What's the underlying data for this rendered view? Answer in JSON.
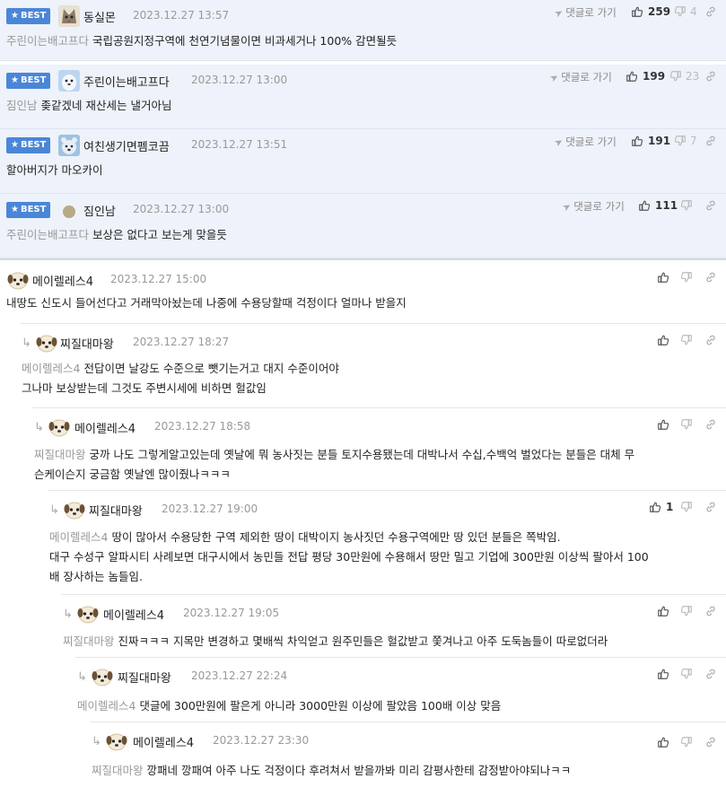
{
  "best": [
    {
      "badge": "BEST",
      "nick": "동실몬",
      "date": "2023.12.27 13:57",
      "reply_link": "댓글로 가기",
      "likes": "259",
      "dislikes": "4",
      "mention": "주린이는배고프다",
      "text": "국립공원지정구역에 천연기념물이면 비과세거나 100% 감면될듯",
      "avatar": "wolf"
    },
    {
      "badge": "BEST",
      "nick": "주린이는배고프다",
      "date": "2023.12.27 13:00",
      "reply_link": "댓글로 가기",
      "likes": "199",
      "dislikes": "23",
      "mention": "짐인남",
      "text": "좆같겠네 재산세는 낼거아님",
      "avatar": "seal"
    },
    {
      "badge": "BEST",
      "nick": "여친생기면펨코끔",
      "date": "2023.12.27 13:51",
      "reply_link": "댓글로 가기",
      "likes": "191",
      "dislikes": "7",
      "mention": "",
      "text": "할아버지가 마오카이",
      "avatar": "bear"
    },
    {
      "badge": "BEST",
      "nick": "짐인남",
      "date": "2023.12.27 13:00",
      "reply_link": "댓글로 가기",
      "likes": "111",
      "dislikes": "",
      "mention": "주린이는배고프다",
      "text": "보상은 없다고 보는게 맞을듯",
      "avatar": "dot"
    }
  ],
  "comments": [
    {
      "nick": "메이렐레스4",
      "date": "2023.12.27 15:00",
      "likes": "",
      "mention": "",
      "lines": [
        "내땅도 신도시 들어선다고 거래막아놨는데 나중에 수용당할때 걱정이다 얼마나 받을지"
      ]
    },
    {
      "nick": "찌질대마왕",
      "date": "2023.12.27 18:27",
      "likes": "",
      "mention": "메이렐레스4",
      "lines": [
        "전답이면 날강도 수준으로 뺏기는거고 대지 수준이어야",
        "그나마 보상받는데 그것도 주변시세에 비하면 헐값임"
      ]
    },
    {
      "nick": "메이렐레스4",
      "date": "2023.12.27 18:58",
      "likes": "",
      "mention": "찌질대마왕",
      "lines": [
        "궁까 나도 그렇게알고있는데 옛날에 뭐 농사짓는 분들 토지수용됐는데 대박나서 수십,수백억 벌었다는 분들은 대체 무",
        "슨케이슨지 궁금함 옛날엔 많이줬나ㅋㅋㅋ"
      ]
    },
    {
      "nick": "찌질대마왕",
      "date": "2023.12.27 19:00",
      "likes": "1",
      "mention": "메이렐레스4",
      "lines": [
        "땅이 많아서 수용당한 구역 제외한 땅이 대박이지 농사짓던 수용구역에만 땅 있던 분들은 쪽박임.",
        "대구 수성구 알파시티 사례보면 대구시에서 농민들 전답 평당 30만원에 수용해서 땅만 밀고 기업에 300만원 이상씩 팔아서 100",
        "배 장사하는 놈들임."
      ]
    },
    {
      "nick": "메이렐레스4",
      "date": "2023.12.27 19:05",
      "likes": "",
      "mention": "찌질대마왕",
      "lines": [
        "진짜ㅋㅋㅋ 지목만 변경하고 몇배씩 차익얻고 원주민들은 헐값받고 쫓겨나고 아주 도둑놈들이 따로없더라"
      ]
    },
    {
      "nick": "찌질대마왕",
      "date": "2023.12.27 22:24",
      "likes": "",
      "mention": "메이렐레스4",
      "lines": [
        "댓글에 300만원에 팔은게 아니라 3000만원 이상에 팔았음 100배 이상 맞음"
      ]
    },
    {
      "nick": "메이렐레스4",
      "date": "2023.12.27 23:30",
      "likes": "",
      "mention": "찌질대마왕",
      "lines": [
        "깡패네 깡패여 아주 나도 걱정이다 후려쳐서 받을까봐 미리 감평사한테 감정받아야되나ㅋㅋ"
      ]
    }
  ]
}
